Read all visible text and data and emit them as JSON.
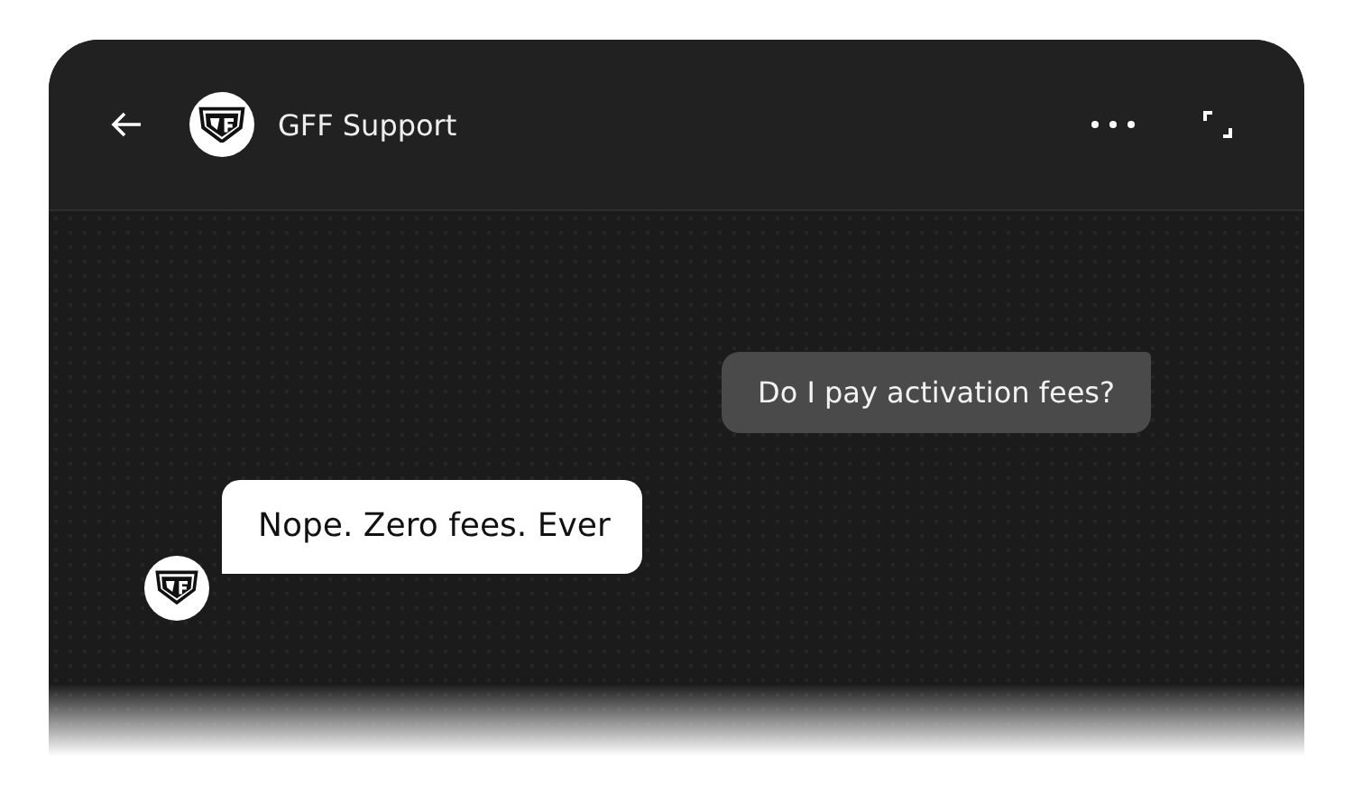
{
  "header": {
    "title": "GFF Support"
  },
  "messages": [
    {
      "kind": "sent",
      "text": "Do I pay activation fees?"
    },
    {
      "kind": "received",
      "text": "Nope. Zero fees. Ever"
    }
  ]
}
